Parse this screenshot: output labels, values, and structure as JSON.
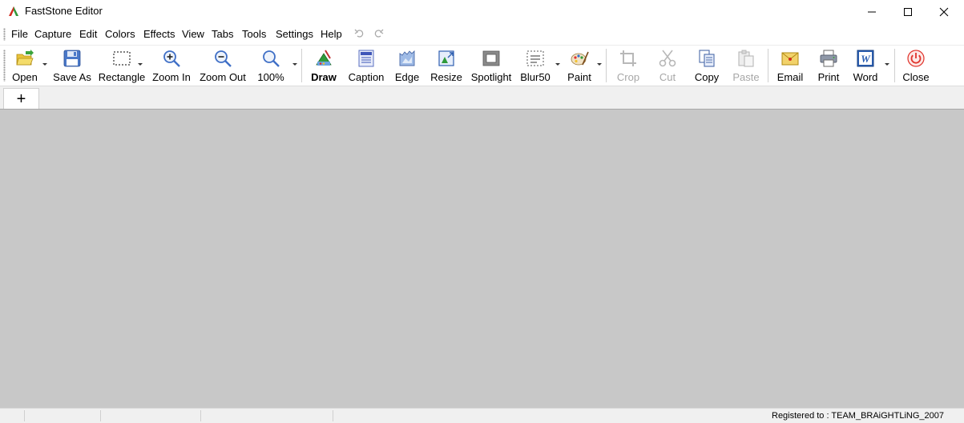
{
  "window": {
    "title": "FastStone Editor"
  },
  "menu": {
    "items": [
      "File",
      "Capture",
      "Edit",
      "Colors",
      "Effects",
      "View",
      "Tabs",
      "Tools",
      "Settings",
      "Help"
    ]
  },
  "toolbar": {
    "open": "Open",
    "save_as": "Save As",
    "rectangle": "Rectangle",
    "zoom_in": "Zoom In",
    "zoom_out": "Zoom Out",
    "zoom_level": "100%",
    "draw": "Draw",
    "caption": "Caption",
    "edge": "Edge",
    "resize": "Resize",
    "spotlight": "Spotlight",
    "blur": "Blur50",
    "paint": "Paint",
    "crop": "Crop",
    "cut": "Cut",
    "copy": "Copy",
    "paste": "Paste",
    "email": "Email",
    "print": "Print",
    "word": "Word",
    "close": "Close"
  },
  "tabs": {
    "add_label": "+"
  },
  "status": {
    "registration": "Registered to : TEAM_BRAiGHTLiNG_2007"
  },
  "icons": {
    "app": "faststone-app-icon",
    "minimize": "minimize-icon",
    "maximize": "maximize-icon",
    "close": "close-icon",
    "undo": "undo-icon",
    "redo": "redo-icon"
  },
  "colors": {
    "canvas": "#c8c8c8",
    "accent_blue": "#3f6fc6",
    "close_red": "#e0332b"
  }
}
